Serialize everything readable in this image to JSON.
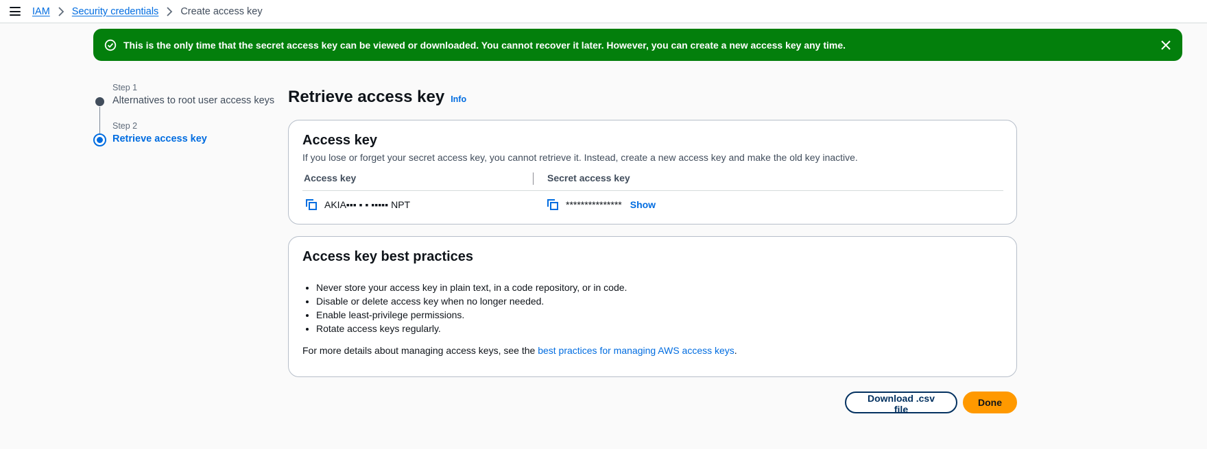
{
  "breadcrumb": {
    "items": [
      {
        "label": "IAM"
      },
      {
        "label": "Security credentials"
      }
    ],
    "current": "Create access key"
  },
  "flash": {
    "message": "This is the only time that the secret access key can be viewed or downloaded. You cannot recover it later. However, you can create a new access key any time."
  },
  "wizard": {
    "steps": [
      {
        "number": "Step 1",
        "label": "Alternatives to root user access keys"
      },
      {
        "number": "Step 2",
        "label": "Retrieve access key"
      }
    ]
  },
  "page": {
    "title": "Retrieve access key",
    "info_label": "Info"
  },
  "access_key_card": {
    "title": "Access key",
    "description": "If you lose or forget your secret access key, you cannot retrieve it. Instead, create a new access key and make the old key inactive.",
    "col_access_key": "Access key",
    "col_secret_key": "Secret access key",
    "access_key_value": "AKIA▪▪▪ ▪ ▪ ▪▪▪▪▪ NPT",
    "secret_key_value": "***************",
    "show_label": "Show"
  },
  "best_practices": {
    "title": "Access key best practices",
    "items": [
      "Never store your access key in plain text, in a code repository, or in code.",
      "Disable or delete access key when no longer needed.",
      "Enable least-privilege permissions.",
      "Rotate access keys regularly."
    ],
    "more_prefix": "For more details about managing access keys, see the ",
    "more_link": "best practices for managing AWS access keys",
    "more_suffix": "."
  },
  "actions": {
    "download_label": "Download .csv file",
    "done_label": "Done"
  },
  "colors": {
    "success": "#037f0c",
    "link": "#006ce0",
    "primary_button": "#ff9900",
    "normal_button_border": "#033160"
  }
}
